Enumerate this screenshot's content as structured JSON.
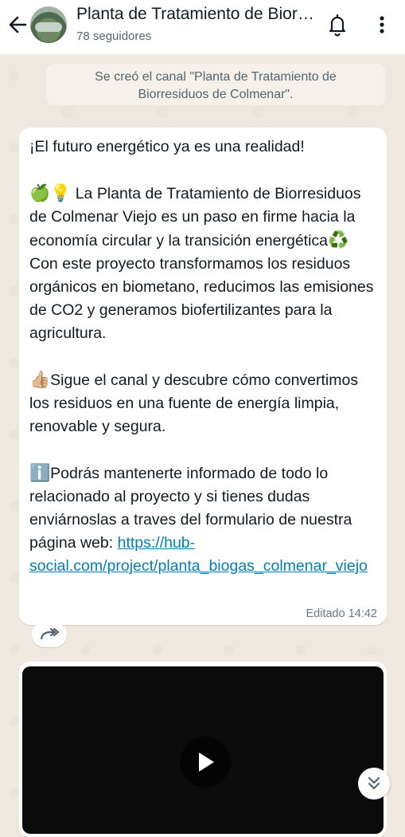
{
  "header": {
    "title": "Planta de Tratamiento de Biorresiduos de Colmenar",
    "followers": "78 seguidores",
    "icons": {
      "back": "arrow-left-icon",
      "bell": "bell-icon",
      "menu": "more-vert-icon"
    }
  },
  "notice": {
    "line1": "Se creó el canal \"Planta de Tratamiento de",
    "line2": "Biorresiduos de Colmenar\"."
  },
  "message": {
    "p1": "¡El futuro energético ya es una realidad!",
    "p2_emoji": "🍏💡",
    "p2_text": " La Planta de Tratamiento de Biorresiduos de Colmenar Viejo es un paso en firme hacia la economía circular y la transición energética",
    "p2_emoji2": "♻️",
    "p2_text2": " Con este proyecto transformamos los residuos orgánicos en biometano, reducimos las emisiones de CO2 y generamos biofertilizantes para la agricultura.",
    "p3_emoji": "👍🏼",
    "p3_text": "Sigue el canal y descubre cómo convertimos los residuos en una fuente de energía limpia, renovable y segura.",
    "p4_emoji": "ℹ️",
    "p4_text": "Podrás mantenerte informado de todo lo relacionado al proyecto y si tienes dudas enviárnoslas a traves del formulario de nuestra página web: ",
    "link": "https://hub-social.com/project/planta_biogas_colmenar_viejo",
    "meta": "Editado 14:42"
  },
  "colors": {
    "link": "#027eb5",
    "bubble": "#ffffff",
    "wallpaper": "#efe8de"
  }
}
